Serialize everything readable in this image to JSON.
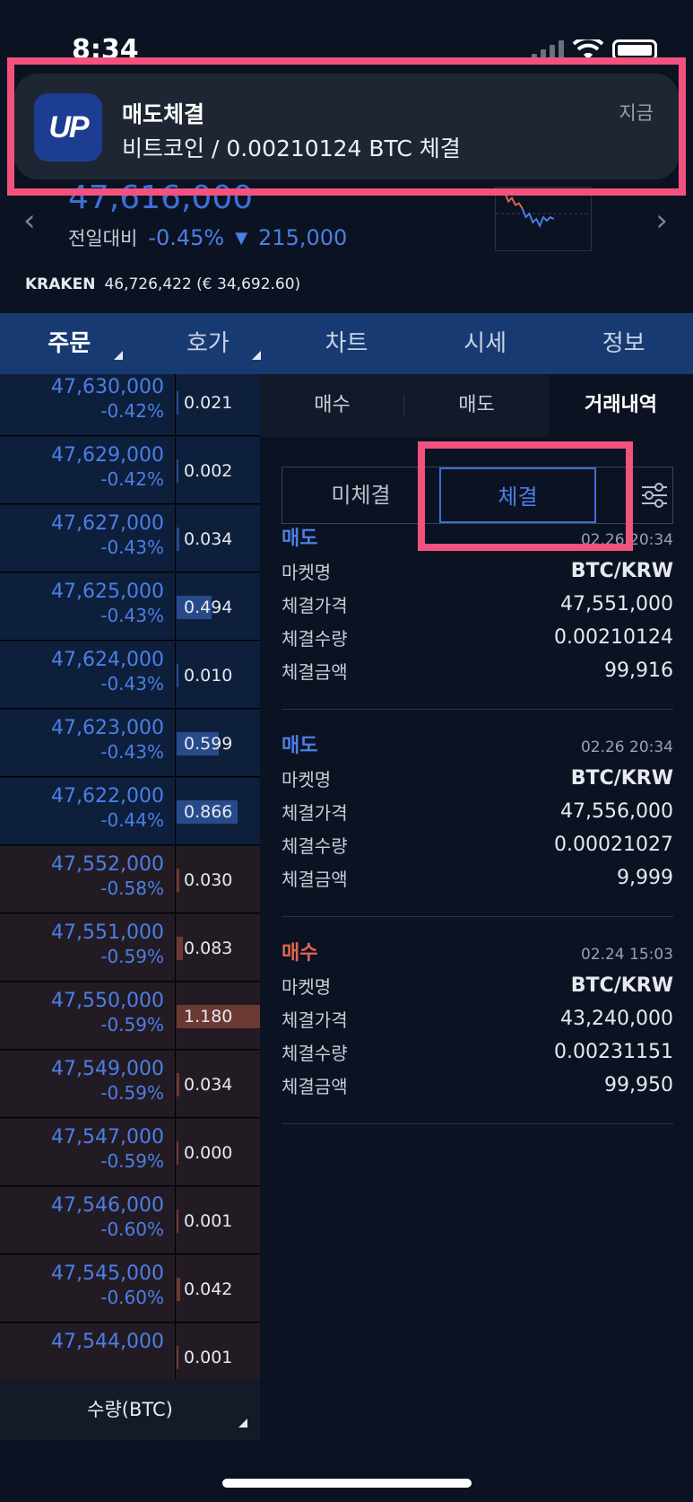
{
  "status_bar": {
    "time": "8:34"
  },
  "ticker": {
    "price": "47,616,000",
    "change_label": "전일대비",
    "change_pct": "-0.45%",
    "change_arrow": "▼",
    "change_amount": "215,000",
    "colors": {
      "down": "#4b7fe6",
      "up": "#e2644f"
    }
  },
  "kraken": {
    "exchange": "KRAKEN",
    "price": "46,726,422 (€ 34,692.60)"
  },
  "main_tabs": [
    {
      "label": "주문",
      "active": true
    },
    {
      "label": "호가",
      "active": false
    },
    {
      "label": "차트",
      "active": false
    },
    {
      "label": "시세",
      "active": false
    },
    {
      "label": "정보",
      "active": false
    }
  ],
  "orderbook": {
    "asks": [
      {
        "price": "47,630,000",
        "pct": "-0.42%",
        "qty": "0.021",
        "level": 0.02
      },
      {
        "price": "47,629,000",
        "pct": "-0.42%",
        "qty": "0.002",
        "level": 0.01
      },
      {
        "price": "47,627,000",
        "pct": "-0.43%",
        "qty": "0.034",
        "level": 0.03
      },
      {
        "price": "47,625,000",
        "pct": "-0.43%",
        "qty": "0.494",
        "level": 0.42
      },
      {
        "price": "47,624,000",
        "pct": "-0.43%",
        "qty": "0.010",
        "level": 0.01
      },
      {
        "price": "47,623,000",
        "pct": "-0.43%",
        "qty": "0.599",
        "level": 0.51
      },
      {
        "price": "47,622,000",
        "pct": "-0.44%",
        "qty": "0.866",
        "level": 0.73
      }
    ],
    "bids": [
      {
        "price": "47,552,000",
        "pct": "-0.58%",
        "qty": "0.030",
        "level": 0.03
      },
      {
        "price": "47,551,000",
        "pct": "-0.59%",
        "qty": "0.083",
        "level": 0.07
      },
      {
        "price": "47,550,000",
        "pct": "-0.59%",
        "qty": "1.180",
        "level": 1.0
      },
      {
        "price": "47,549,000",
        "pct": "-0.59%",
        "qty": "0.034",
        "level": 0.03
      },
      {
        "price": "47,547,000",
        "pct": "-0.59%",
        "qty": "0.000",
        "level": 0.0
      },
      {
        "price": "47,546,000",
        "pct": "-0.60%",
        "qty": "0.001",
        "level": 0.0
      },
      {
        "price": "47,545,000",
        "pct": "-0.60%",
        "qty": "0.042",
        "level": 0.04
      },
      {
        "price": "47,544,000",
        "pct": "",
        "qty": "0.001",
        "level": 0.0
      }
    ],
    "footer_label": "수량(BTC)"
  },
  "order_tabs": [
    {
      "label": "매수",
      "active": false
    },
    {
      "label": "매도",
      "active": false
    },
    {
      "label": "거래내역",
      "active": true
    }
  ],
  "history_segments": {
    "pending": "미체결",
    "filled": "체결",
    "selected": "filled"
  },
  "trades": [
    {
      "type": "매도",
      "side": "sell",
      "time": "02.26 20:34",
      "fields": [
        {
          "label": "마켓명",
          "value": "BTC/KRW"
        },
        {
          "label": "체결가격",
          "value": "47,551,000"
        },
        {
          "label": "체결수량",
          "value": "0.00210124"
        },
        {
          "label": "체결금액",
          "value": "99,916"
        }
      ]
    },
    {
      "type": "매도",
      "side": "sell",
      "time": "02.26 20:34",
      "fields": [
        {
          "label": "마켓명",
          "value": "BTC/KRW"
        },
        {
          "label": "체결가격",
          "value": "47,556,000"
        },
        {
          "label": "체결수량",
          "value": "0.00021027"
        },
        {
          "label": "체결금액",
          "value": "9,999"
        }
      ]
    },
    {
      "type": "매수",
      "side": "buy",
      "time": "02.24 15:03",
      "fields": [
        {
          "label": "마켓명",
          "value": "BTC/KRW"
        },
        {
          "label": "체결가격",
          "value": "43,240,000"
        },
        {
          "label": "체결수량",
          "value": "0.00231151"
        },
        {
          "label": "체결금액",
          "value": "99,950"
        }
      ]
    }
  ],
  "notification": {
    "app_logo": "UP",
    "title": "매도체결",
    "body": "비트코인 / 0.00210124 BTC 체결",
    "time": "지금"
  },
  "highlight_color": "#f2527d"
}
